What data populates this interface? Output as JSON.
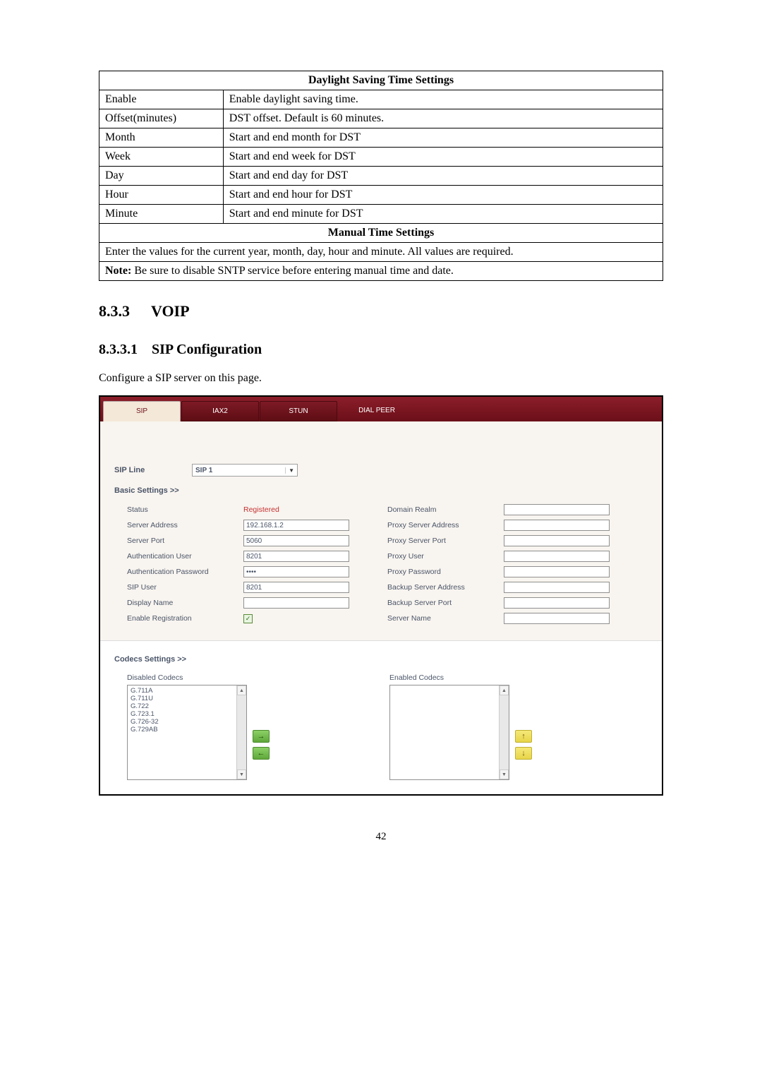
{
  "dst": {
    "title": "Daylight Saving Time Settings",
    "rows": [
      {
        "label": "Enable",
        "desc": "Enable daylight saving time."
      },
      {
        "label": "Offset(minutes)",
        "desc": "DST offset.    Default is 60 minutes."
      },
      {
        "label": "Month",
        "desc": "Start and end month for DST"
      },
      {
        "label": "Week",
        "desc": "Start and end week for DST"
      },
      {
        "label": "Day",
        "desc": "Start and end day for DST"
      },
      {
        "label": "Hour",
        "desc": "Start and end hour for DST"
      },
      {
        "label": "Minute",
        "desc": "Start and end minute for DST"
      }
    ],
    "manual_title": "Manual Time Settings",
    "manual_row": "Enter the values for the current year, month, day, hour and minute.    All values are required.",
    "note_bold": "Note:",
    "note_rest": " Be sure to disable SNTP service before entering manual time and date."
  },
  "headings": {
    "voip_num": "8.3.3",
    "voip_title": "VOIP",
    "sipconf_num": "8.3.3.1",
    "sipconf_title": "SIP Configuration",
    "intro": "Configure a SIP server on this page."
  },
  "voip": {
    "tabs": {
      "sip": "SIP",
      "iax2": "IAX2",
      "stun": "STUN",
      "dialpeer": "DIAL PEER"
    },
    "sip_line_label": "SIP Line",
    "sip_line_value": "SIP 1",
    "basic_title": "Basic Settings >>",
    "left": [
      {
        "label": "Status",
        "type": "status",
        "value": "Registered"
      },
      {
        "label": "Server Address",
        "type": "input",
        "value": "192.168.1.2"
      },
      {
        "label": "Server Port",
        "type": "input",
        "value": "5060"
      },
      {
        "label": "Authentication User",
        "type": "input",
        "value": "8201"
      },
      {
        "label": "Authentication Password",
        "type": "input",
        "value": "••••"
      },
      {
        "label": "SIP User",
        "type": "input",
        "value": "8201"
      },
      {
        "label": "Display Name",
        "type": "input",
        "value": ""
      },
      {
        "label": "Enable Registration",
        "type": "checkbox",
        "value": "✓"
      }
    ],
    "right": [
      {
        "label": "Domain Realm",
        "type": "input",
        "value": ""
      },
      {
        "label": "Proxy Server Address",
        "type": "input",
        "value": ""
      },
      {
        "label": "Proxy Server Port",
        "type": "input",
        "value": ""
      },
      {
        "label": "Proxy User",
        "type": "input",
        "value": ""
      },
      {
        "label": "Proxy Password",
        "type": "input",
        "value": ""
      },
      {
        "label": "Backup Server Address",
        "type": "input",
        "value": ""
      },
      {
        "label": "Backup Server Port",
        "type": "input",
        "value": ""
      },
      {
        "label": "Server Name",
        "type": "input",
        "value": ""
      }
    ],
    "codecs_title": "Codecs Settings >>",
    "disabled_label": "Disabled Codecs",
    "enabled_label": "Enabled Codecs",
    "disabled_codecs": [
      "G.711A",
      "G.711U",
      "G.722",
      "G.723.1",
      "G.726-32",
      "G.729AB"
    ]
  },
  "page_number": "42"
}
